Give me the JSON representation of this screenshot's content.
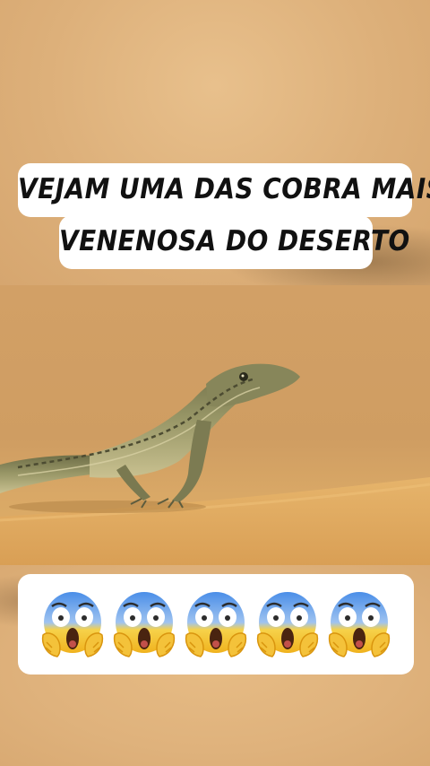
{
  "caption": {
    "line1": "VEJAM UMA DAS COBRA MAIS",
    "line2": "VENENOSA DO DESERTO"
  },
  "reactions": {
    "emoji": "😱",
    "count": 5,
    "icon_name": "face-screaming-in-fear-icon"
  },
  "colors": {
    "sand": "#e0af66",
    "card": "#ffffff",
    "text": "#111111",
    "lizard": "#8a8a5a"
  }
}
